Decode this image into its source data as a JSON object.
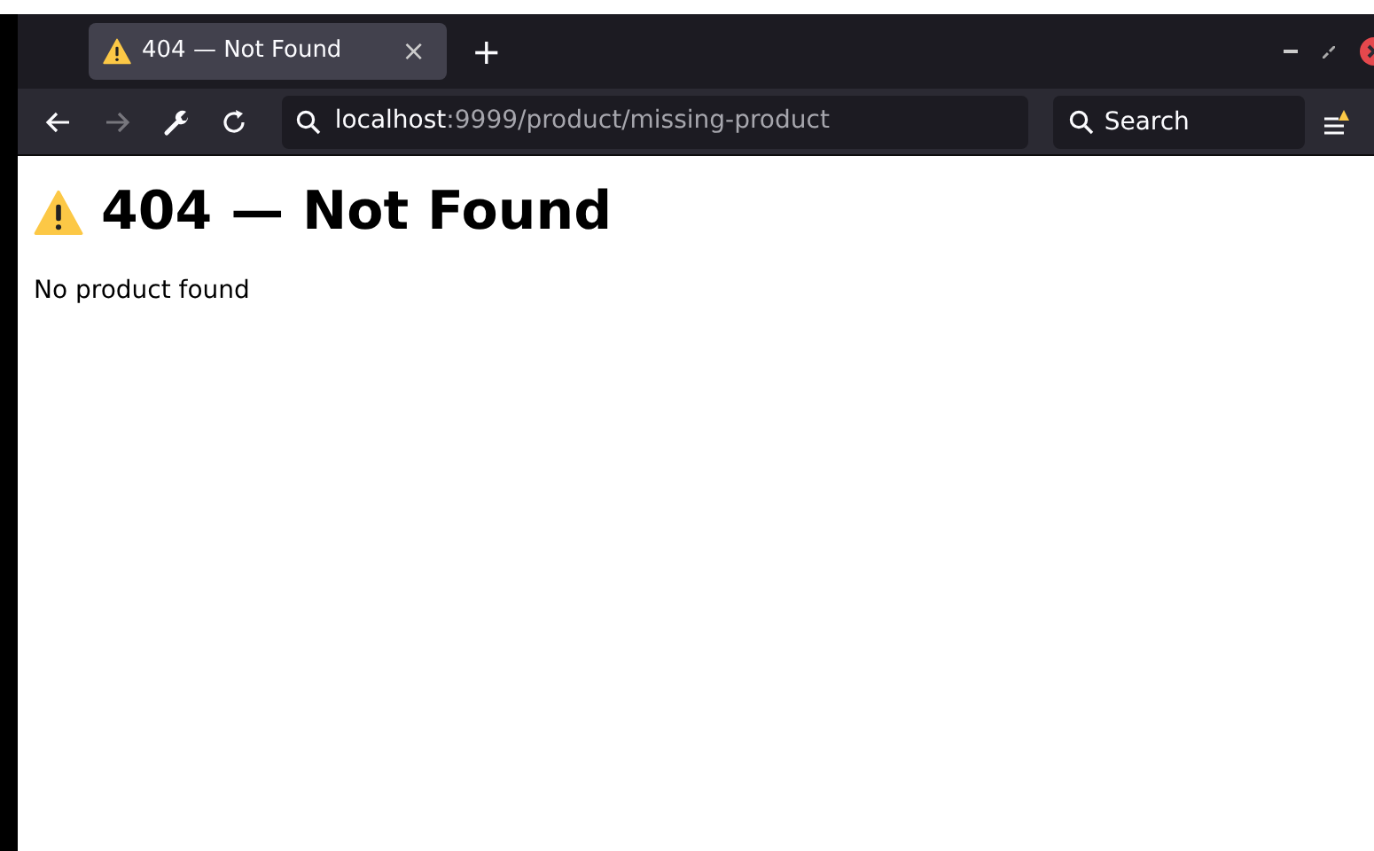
{
  "tabs": [
    {
      "title": "404 — Not Found",
      "close": "×",
      "selected": true
    }
  ],
  "new_tab": "+",
  "toolbar": {
    "back": {
      "disabled": false
    },
    "forward": {
      "disabled": true
    }
  },
  "url": {
    "host": "localhost",
    "path": ":9999/product/missing-product"
  },
  "search": {
    "placeholder": "Search"
  },
  "page": {
    "heading": "404 — Not Found",
    "message": "No product found"
  }
}
